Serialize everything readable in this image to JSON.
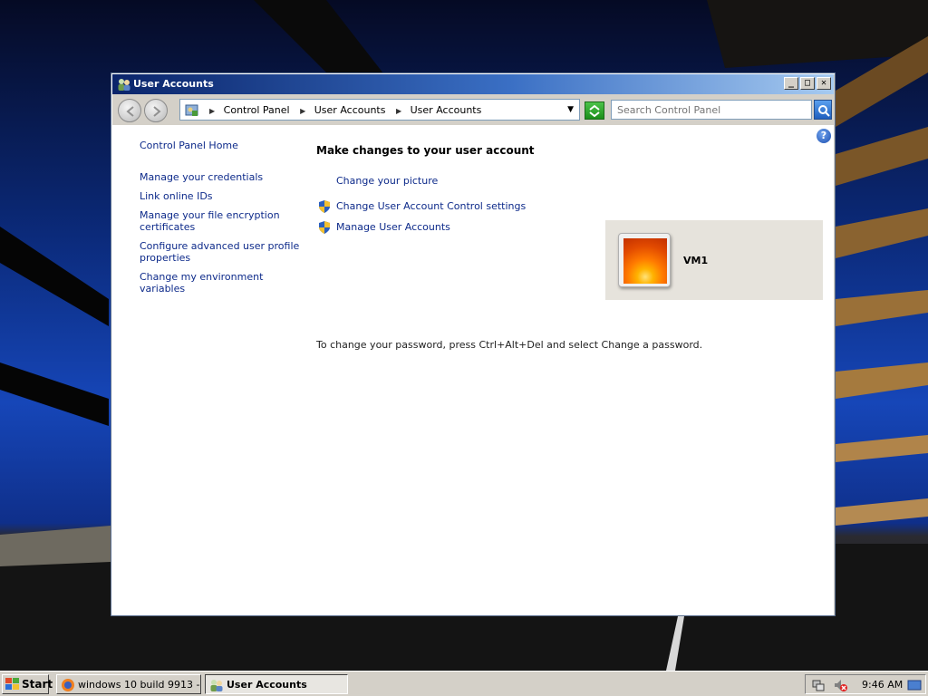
{
  "window": {
    "title": "User Accounts",
    "caption_buttons": {
      "minimize": "_",
      "maximize": "□",
      "close": "✕"
    }
  },
  "address_bar": {
    "crumbs": [
      "Control Panel",
      "User Accounts",
      "User Accounts"
    ]
  },
  "search": {
    "placeholder": "Search Control Panel"
  },
  "help": {
    "label": "?"
  },
  "left_nav": {
    "home": "Control Panel Home",
    "items": [
      "Manage your credentials",
      "Link online IDs",
      "Manage your file encryption certificates",
      "Configure advanced user profile properties",
      "Change my environment variables"
    ]
  },
  "main": {
    "title": "Make changes to your user account",
    "tasks": [
      "Change your picture",
      "Change User Account Control settings",
      "Manage User Accounts"
    ],
    "password_note": "To change your password, press Ctrl+Alt+Del and select Change a password."
  },
  "account": {
    "name": "VM1"
  },
  "taskbar": {
    "start_label": "Start",
    "buttons": [
      "windows 10 build 9913 - ...",
      "User Accounts"
    ],
    "clock": "9:46 AM"
  },
  "colors": {
    "link": "#0d2a8a",
    "titlebar_start": "#0a246a",
    "titlebar_end": "#a6caf0"
  },
  "icons": {
    "title": "users-icon",
    "address": "control-panel-icon",
    "refresh": "refresh-icon",
    "search": "search-icon",
    "shield": "uac-shield-icon",
    "browser": "firefox-icon"
  }
}
